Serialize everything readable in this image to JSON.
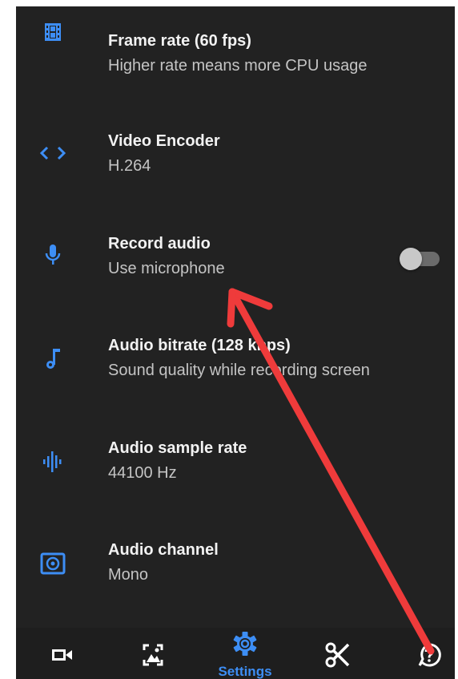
{
  "settings": [
    {
      "title": "Frame rate (60 fps)",
      "subtitle": "Higher rate means more CPU usage",
      "icon": "film-strip-icon"
    },
    {
      "title": "Video Encoder",
      "subtitle": "H.264",
      "icon": "code-brackets-icon"
    },
    {
      "title": "Record audio",
      "subtitle": "Use microphone",
      "icon": "microphone-icon",
      "toggle": false
    },
    {
      "title": "Audio bitrate (128 kbps)",
      "subtitle": "Sound quality while recording screen",
      "icon": "music-note-icon"
    },
    {
      "title": "Audio sample rate",
      "subtitle": "44100 Hz",
      "icon": "audio-wave-icon"
    },
    {
      "title": "Audio channel",
      "subtitle": "Mono",
      "icon": "speaker-icon"
    }
  ],
  "bottom_nav": {
    "items": [
      {
        "icon": "video-camera-icon"
      },
      {
        "icon": "image-icon"
      },
      {
        "icon": "gear-icon",
        "label": "Settings",
        "active": true
      },
      {
        "icon": "scissors-icon"
      },
      {
        "icon": "help-icon"
      }
    ]
  },
  "colors": {
    "background": "#222222",
    "accent": "#3d8ef5",
    "annotation": "#ef3b3b"
  }
}
